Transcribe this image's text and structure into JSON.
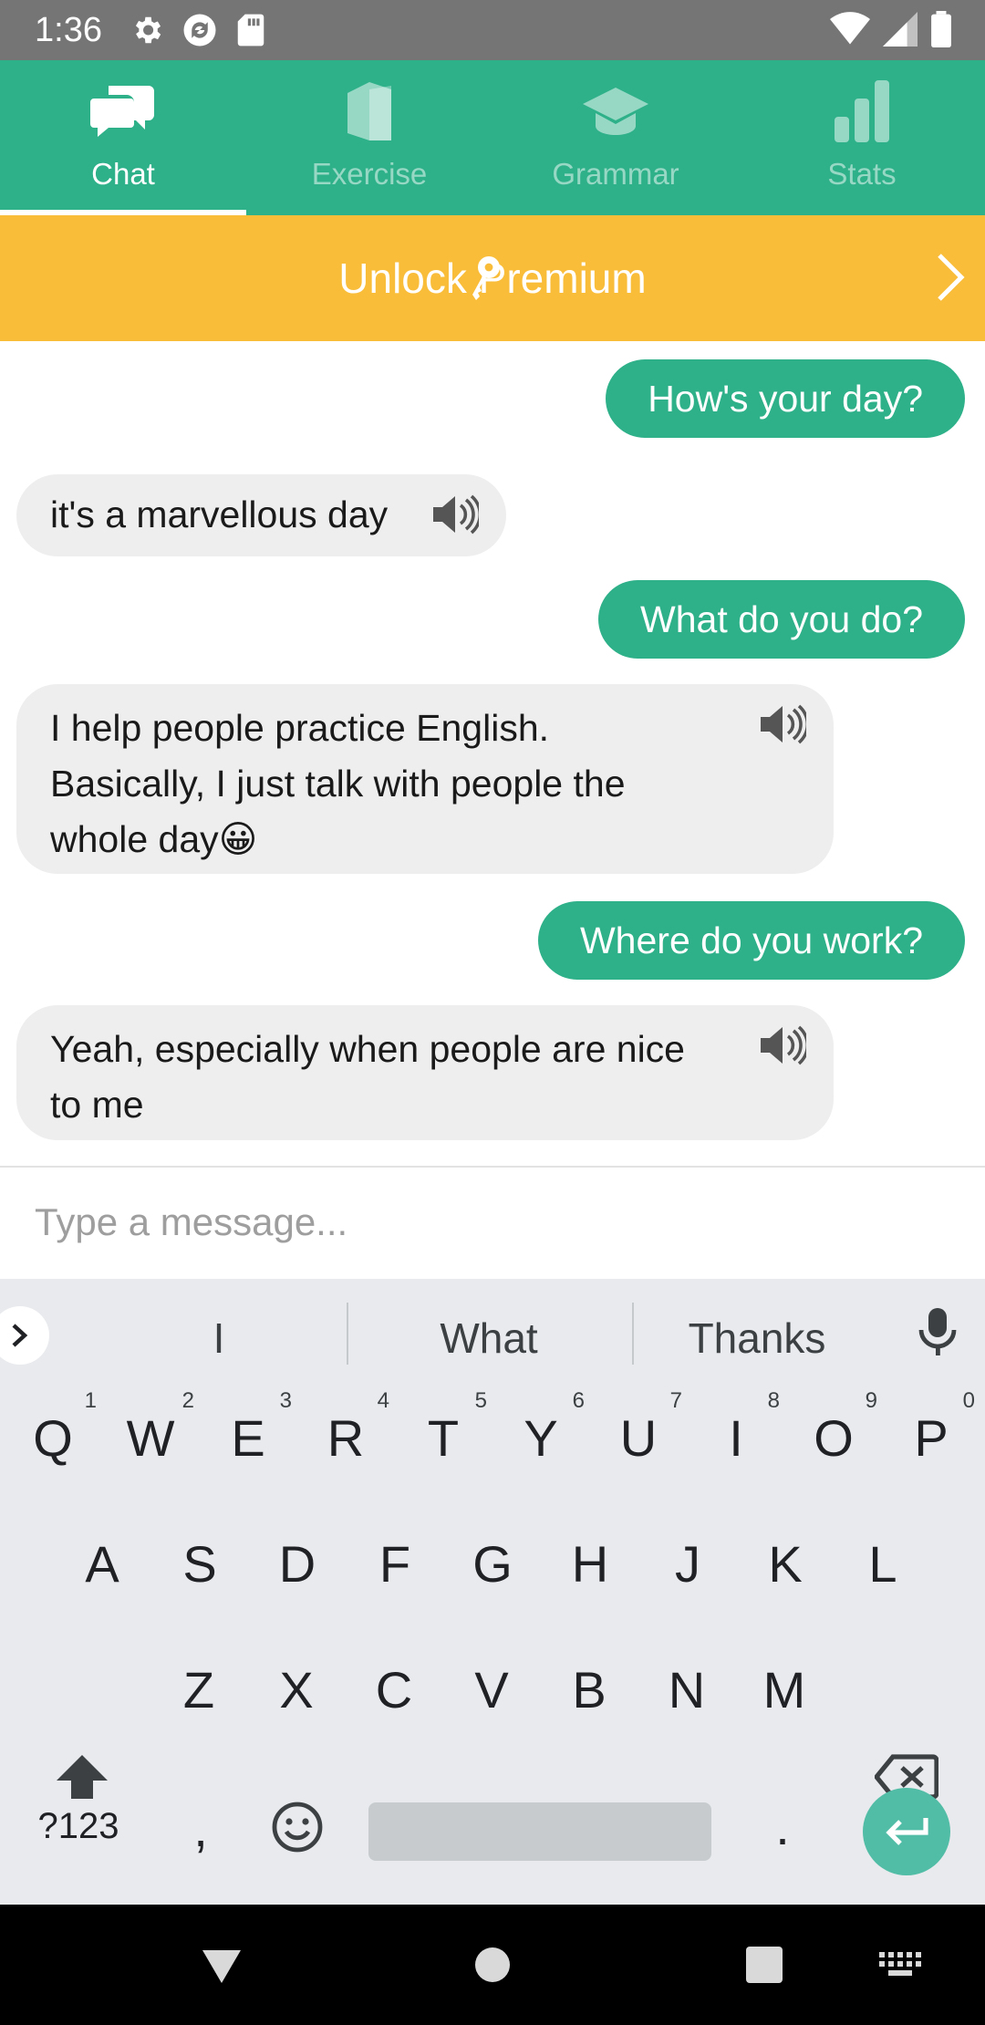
{
  "status_bar": {
    "time": "1:36"
  },
  "tabs": [
    {
      "label": "Chat",
      "icon": "chat-bubbles-icon",
      "active": true
    },
    {
      "label": "Exercise",
      "icon": "book-icon",
      "active": false
    },
    {
      "label": "Grammar",
      "icon": "graduation-cap-icon",
      "active": false
    },
    {
      "label": "Stats",
      "icon": "bar-chart-icon",
      "active": false
    }
  ],
  "premium": {
    "label": "Unlock Premium",
    "icon": "key-icon"
  },
  "messages": [
    {
      "from": "me",
      "text": "How's your day?"
    },
    {
      "from": "bot",
      "text": "it's a marvellous day"
    },
    {
      "from": "me",
      "text": "What do you do?"
    },
    {
      "from": "bot",
      "lines": [
        "I help people practice English.",
        "Basically, I just talk with people the",
        "whole day😀"
      ]
    },
    {
      "from": "me",
      "text": "Where do you work?"
    },
    {
      "from": "bot",
      "lines": [
        "Yeah, especially when people are nice",
        "to me"
      ]
    }
  ],
  "input": {
    "placeholder": "Type a message..."
  },
  "keyboard": {
    "suggestions": [
      "I",
      "What",
      "Thanks"
    ],
    "row1": [
      "Q",
      "W",
      "E",
      "R",
      "T",
      "Y",
      "U",
      "I",
      "O",
      "P"
    ],
    "row1_hints": [
      "1",
      "2",
      "3",
      "4",
      "5",
      "6",
      "7",
      "8",
      "9",
      "0"
    ],
    "row2": [
      "A",
      "S",
      "D",
      "F",
      "G",
      "H",
      "J",
      "K",
      "L"
    ],
    "row3": [
      "Z",
      "X",
      "C",
      "V",
      "B",
      "N",
      "M"
    ],
    "symbols_label": "?123",
    "comma": ",",
    "period": "."
  },
  "colors": {
    "primary": "#2eb089",
    "premium": "#f9bd3a",
    "bubble_bot": "#eeeeee",
    "enter": "#52bda6"
  }
}
